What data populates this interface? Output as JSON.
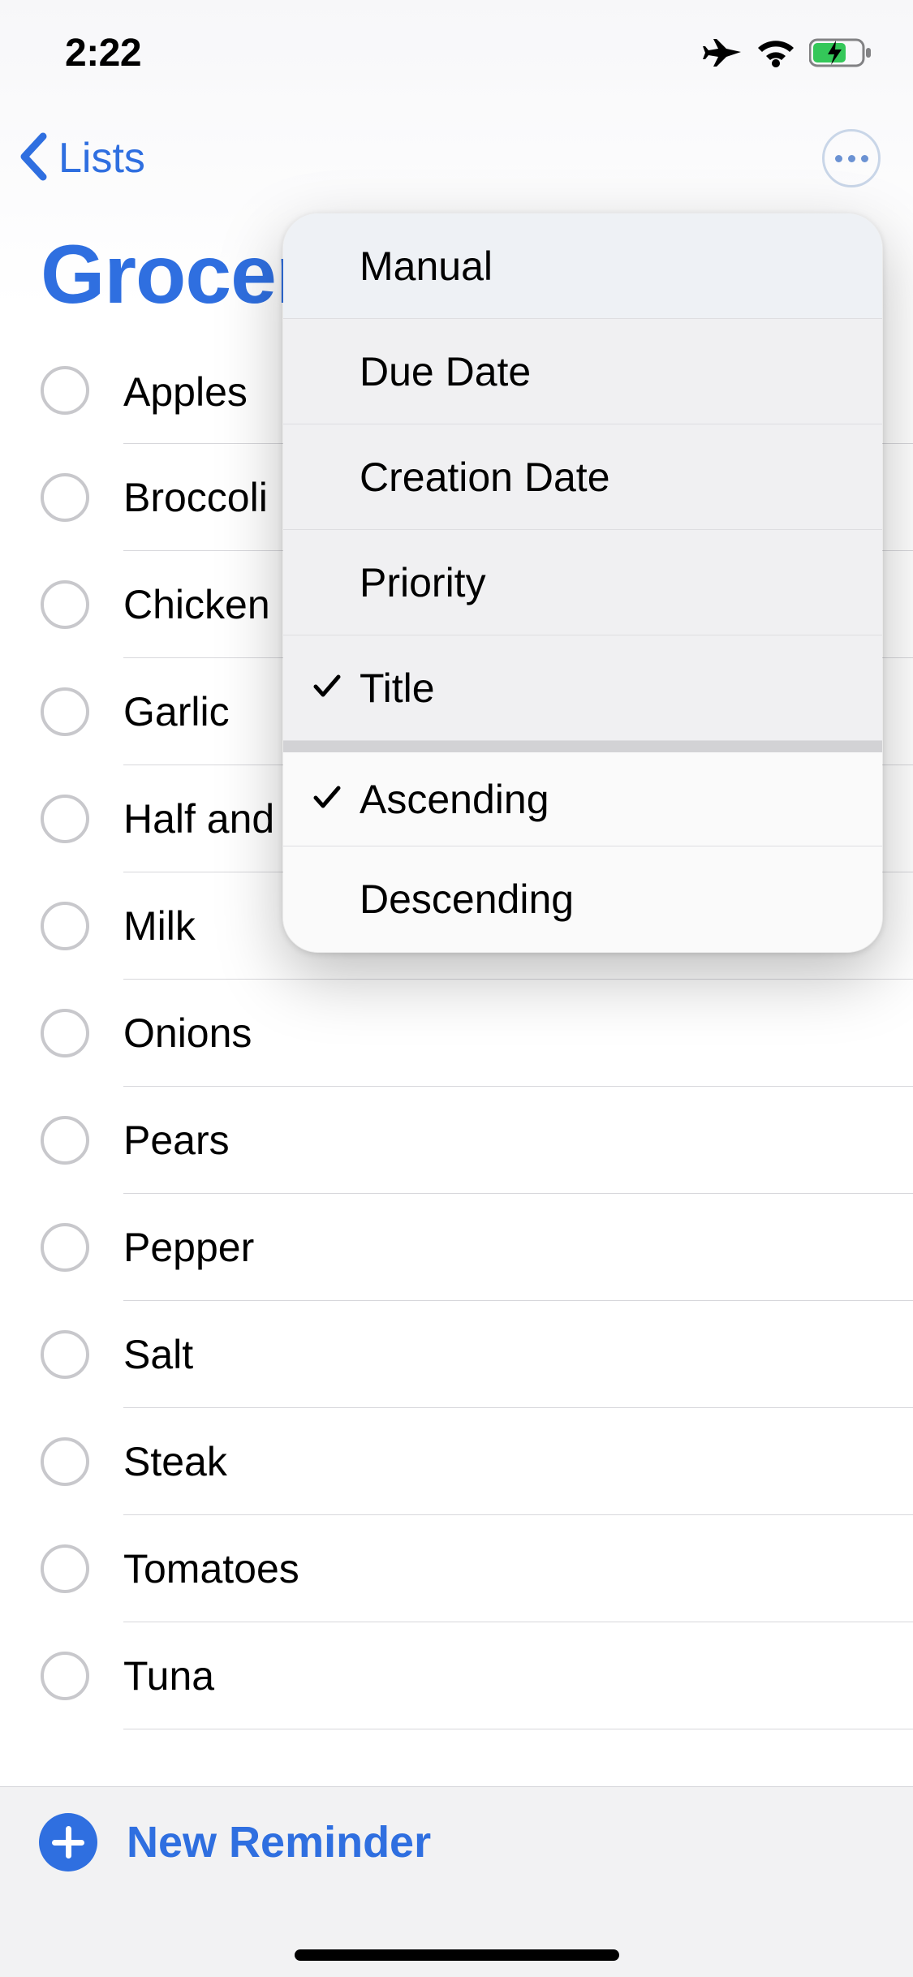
{
  "status": {
    "time": "2:22"
  },
  "nav": {
    "back_label": "Lists"
  },
  "list": {
    "title": "Groceries",
    "items": [
      {
        "label": "Apples"
      },
      {
        "label": "Broccoli"
      },
      {
        "label": "Chicken"
      },
      {
        "label": "Garlic"
      },
      {
        "label": "Half and"
      },
      {
        "label": "Milk"
      },
      {
        "label": "Onions"
      },
      {
        "label": "Pears"
      },
      {
        "label": "Pepper"
      },
      {
        "label": "Salt"
      },
      {
        "label": "Steak"
      },
      {
        "label": "Tomatoes"
      },
      {
        "label": "Tuna"
      }
    ]
  },
  "toolbar": {
    "new_reminder_label": "New Reminder"
  },
  "menu": {
    "sort_options": [
      {
        "label": "Manual",
        "checked": false
      },
      {
        "label": "Due Date",
        "checked": false
      },
      {
        "label": "Creation Date",
        "checked": false
      },
      {
        "label": "Priority",
        "checked": false
      },
      {
        "label": "Title",
        "checked": true
      }
    ],
    "order_options": [
      {
        "label": "Ascending",
        "checked": true
      },
      {
        "label": "Descending",
        "checked": false
      }
    ]
  }
}
